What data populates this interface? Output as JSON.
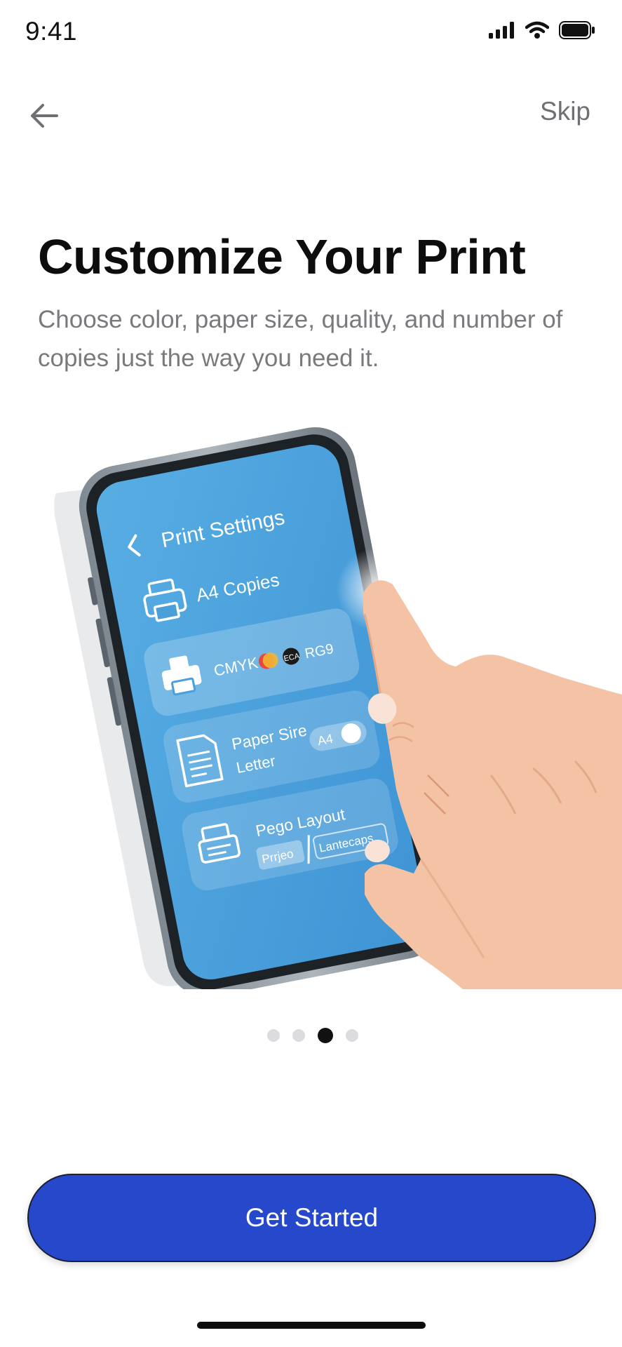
{
  "status_bar": {
    "time": "9:41",
    "icons": [
      "cellular-signal-icon",
      "wifi-icon",
      "battery-icon"
    ]
  },
  "nav": {
    "back_icon": "arrow-left-icon",
    "skip_label": "Skip"
  },
  "onboarding": {
    "title": "Customize Your Print",
    "subtitle": "Choose color, paper size, quality, and number of copies just the way you need it."
  },
  "illustration": {
    "header_title": "Print Settings",
    "row_copies": "A4 Copies",
    "row_color_label": "CMYK",
    "row_color_badge": "ECA",
    "row_color_alt": "RG9",
    "row_paper_title": "Paper Sire",
    "row_paper_sub": "Letter",
    "row_paper_toggle": "A4",
    "row_layout_title": "Pego Layout",
    "row_layout_option_1": "Prrjeo",
    "row_layout_option_2": "Lantecaps"
  },
  "pager": {
    "total": 4,
    "active_index": 2
  },
  "cta": {
    "label": "Get Started"
  },
  "colors": {
    "primary": "#2649CC",
    "screen_blue": "#4A9FD9",
    "skin": "#F4C3A6",
    "title": "#0D0D0D",
    "muted_text": "#7A7A7E"
  }
}
